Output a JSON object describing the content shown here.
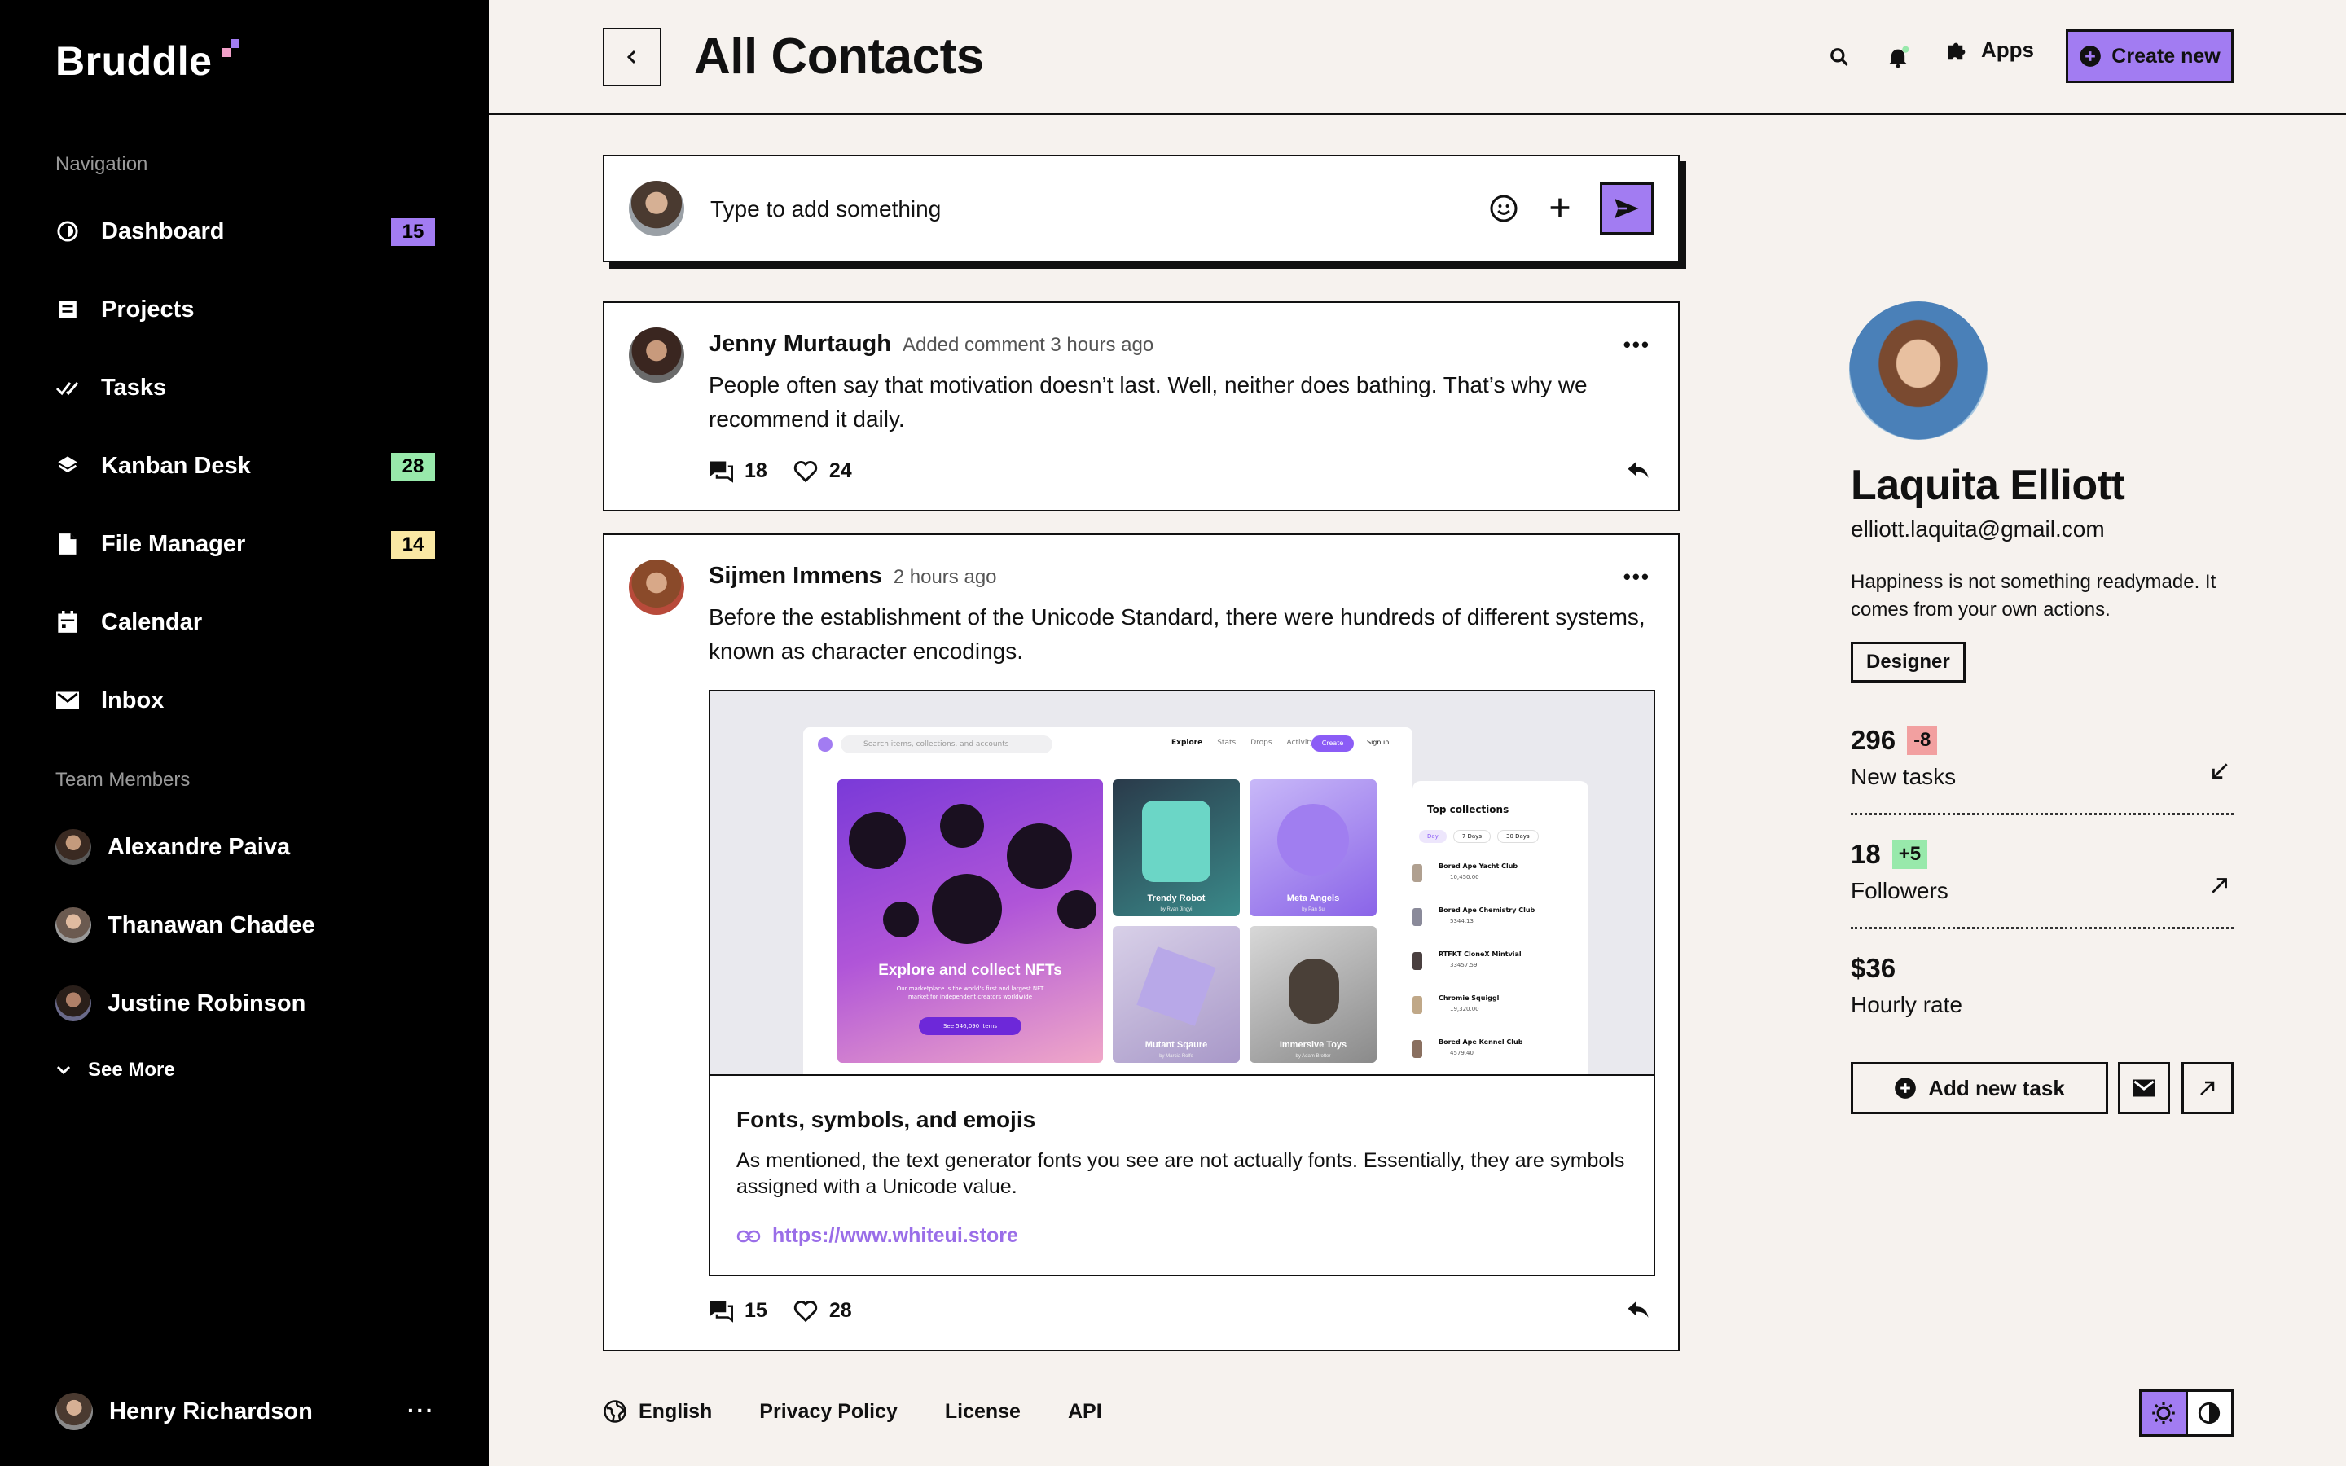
{
  "app": {
    "logo_text": "Bruddle",
    "accent": "#a27cf2"
  },
  "sidebar": {
    "nav_heading": "Navigation",
    "items": [
      {
        "label": "Dashboard",
        "icon": "dashboard-icon",
        "badge": "15",
        "badge_color": "#a27cf2"
      },
      {
        "label": "Projects",
        "icon": "projects-icon"
      },
      {
        "label": "Tasks",
        "icon": "double-check-icon"
      },
      {
        "label": "Kanban Desk",
        "icon": "layers-icon",
        "badge": "28",
        "badge_color": "#98e9ab"
      },
      {
        "label": "File Manager",
        "icon": "file-icon",
        "badge": "14",
        "badge_color": "#fae8a4"
      },
      {
        "label": "Calendar",
        "icon": "calendar-icon"
      },
      {
        "label": "Inbox",
        "icon": "mail-icon"
      }
    ],
    "team_heading": "Team Members",
    "members": [
      {
        "name": "Alexandre Paiva"
      },
      {
        "name": "Thanawan Chadee"
      },
      {
        "name": "Justine Robinson"
      }
    ],
    "see_more": "See More",
    "current_user": {
      "name": "Henry Richardson",
      "more": "···"
    }
  },
  "header": {
    "title": "All Contacts",
    "apps_label": "Apps",
    "create_label": "Create new"
  },
  "composer": {
    "placeholder": "Type to add something"
  },
  "posts": [
    {
      "author": "Jenny Murtaugh",
      "meta": "Added comment 3 hours ago",
      "text": "People often say that motivation doesn’t last. Well, neither does bathing. That’s why we recommend it daily.",
      "comments": "18",
      "likes": "24"
    },
    {
      "author": "Sijmen Immens",
      "meta": "2 hours ago",
      "text": "Before the establishment of the Unicode Standard, there were hundreds of different systems, known as character encodings.",
      "comments": "15",
      "likes": "28",
      "link": {
        "title": "Fonts, symbols, and emojis",
        "description": "As mentioned, the text generator fonts you see are not actually fonts. Essentially, they are symbols assigned with a Unicode value.",
        "url": "https://www.whiteui.store",
        "preview": {
          "search_placeholder": "Search items, collections, and accounts",
          "nav": [
            "Explore",
            "Stats",
            "Drops",
            "Activity"
          ],
          "create": "Create",
          "signin": "Sign in",
          "hero_title": "Explore and collect NFTs",
          "hero_sub": "Our marketplace is the world's first and largest NFT market for independent creators worldwide",
          "hero_btn": "See 546,090 Items",
          "cards": [
            {
              "title": "Trendy Robot",
              "by": "by Ryan Jingyi"
            },
            {
              "title": "Meta Angels",
              "by": "by Pan Su"
            },
            {
              "title": "Mutant Sqaure",
              "by": "by Marcia Rolfe"
            },
            {
              "title": "Immersive Toys",
              "by": "by Adam Brotter"
            }
          ],
          "collections_title": "Top collections",
          "collections_tabs": [
            "Day",
            "7 Days",
            "30 Days"
          ],
          "collections": [
            {
              "name": "Bored Ape Yacht Club",
              "value": "10,450.00"
            },
            {
              "name": "Bored Ape Chemistry Club",
              "value": "5344.13"
            },
            {
              "name": "RTFKT CloneX Mintvial",
              "value": "33457.59"
            },
            {
              "name": "Chromie Squiggl",
              "value": "19,320.00"
            },
            {
              "name": "Bored Ape Kennel Club",
              "value": "4579.40"
            }
          ]
        }
      }
    }
  ],
  "footer": {
    "language": "English",
    "links": [
      "Privacy Policy",
      "License",
      "API"
    ]
  },
  "profile": {
    "name": "Laquita Elliott",
    "email": "elliott.laquita@gmail.com",
    "bio": "Happiness is not something readymade. It comes from your own actions.",
    "tag": "Designer",
    "stats": [
      {
        "value": "296",
        "change": "-8",
        "change_color": "#f2a0a0",
        "label": "New tasks",
        "arrow": "arrow-down-left-icon"
      },
      {
        "value": "18",
        "change": "+5",
        "change_color": "#98e9ab",
        "label": "Followers",
        "arrow": "arrow-up-right-icon"
      },
      {
        "value": "$36",
        "label": "Hourly rate"
      }
    ],
    "add_task_label": "Add new task"
  }
}
